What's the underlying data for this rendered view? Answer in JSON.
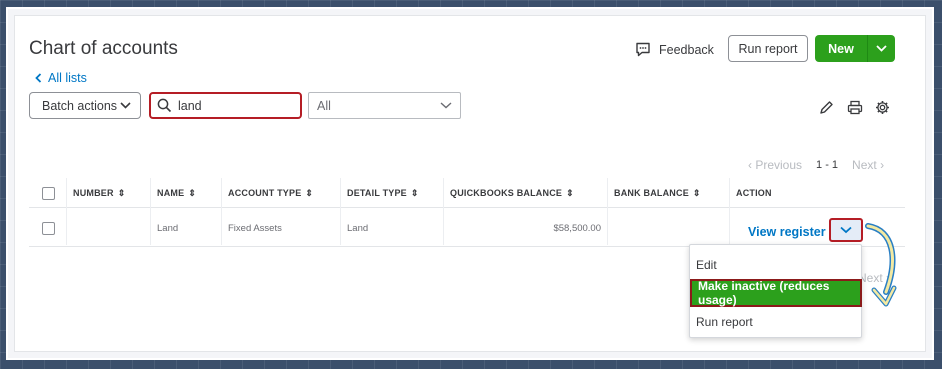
{
  "page": {
    "title": "Chart of accounts",
    "back_link": "All lists",
    "feedback_label": "Feedback",
    "run_report_label": "Run report",
    "new_label": "New"
  },
  "toolbar": {
    "batch_actions_label": "Batch actions",
    "search_value": "land",
    "filter_value": "All",
    "icons": [
      "pencil-icon",
      "printer-icon",
      "gear-icon"
    ]
  },
  "pagination": {
    "previous": "Previous",
    "range": "1 - 1",
    "next": "Next",
    "next_bottom": "Next"
  },
  "table": {
    "columns": [
      "NUMBER",
      "NAME",
      "ACCOUNT TYPE",
      "DETAIL TYPE",
      "QUICKBOOKS BALANCE",
      "BANK BALANCE",
      "ACTION"
    ],
    "rows": [
      {
        "number": "",
        "name": "Land",
        "account_type": "Fixed Assets",
        "detail_type": "Land",
        "quickbooks_balance": "$58,500.00",
        "bank_balance": "",
        "action": "View register"
      }
    ]
  },
  "action_menu": {
    "items": [
      "Edit",
      "Make inactive (reduces usage)",
      "Run report"
    ],
    "highlighted_index": 1
  },
  "colors": {
    "accent_green": "#2ca01c",
    "link_blue": "#0077c5",
    "annotation_red": "#b51d25",
    "annotation_arrow": "#f3e9a2"
  }
}
